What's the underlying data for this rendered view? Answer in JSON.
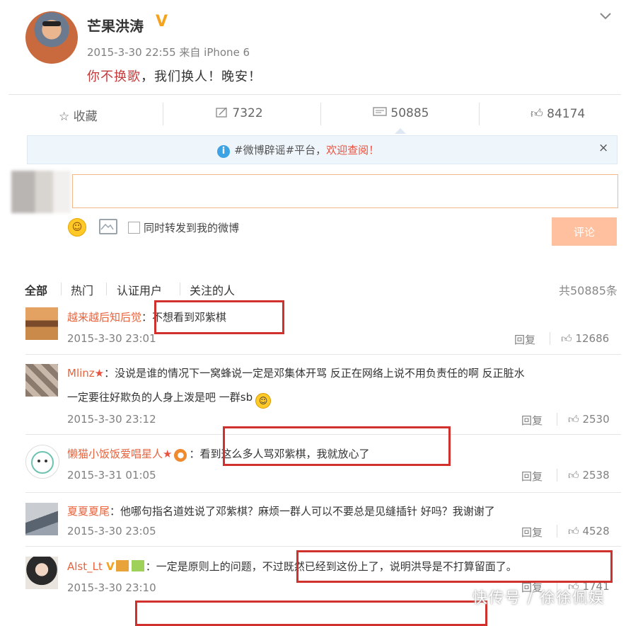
{
  "post": {
    "author": "芒果洪涛",
    "verified_badge": "V",
    "meta": "2015-3-30 22:55 来自 iPhone 6",
    "text_highlight": "你不换歌",
    "text_rest": "，我们换人！晚安！"
  },
  "actions": {
    "favorite": "收藏",
    "repost_count": "7322",
    "comment_count": "50885",
    "like_count": "84174"
  },
  "notice": {
    "text": "#微博辟谣#平台，",
    "link": "欢迎查阅！",
    "close": "×"
  },
  "composer": {
    "forward_label": "同时转发到我的微博",
    "submit_label": "评论"
  },
  "filters": {
    "all": "全部",
    "hot": "热门",
    "verified": "认证用户",
    "following": "关注的人",
    "total": "共50885条"
  },
  "comments": [
    {
      "name": "越来越后知后觉",
      "text": "：不想看到邓紫棋",
      "time": "2015-3-30 23:01",
      "reply": "回复",
      "likes": "12686"
    },
    {
      "name": "Mlinz",
      "text": "：没说是谁的情况下一窝蜂说一定是邓集体开骂 反正在网络上说不用负责任的啊 反正脏水",
      "text2": "一定要往好欺负的人身上泼是吧 一群sb",
      "time": "2015-3-30 23:12",
      "reply": "回复",
      "likes": "2530"
    },
    {
      "name": "懒猫小饭饭爱唱星人",
      "text": "：看到这么多人骂邓紫棋，我就放心了",
      "time": "2015-3-31 01:05",
      "reply": "回复",
      "likes": "2538"
    },
    {
      "name": "夏夏夏尾",
      "text": "：他哪句指名道姓说了邓紫棋？麻烦一群人可以不要总是见缝插针 好吗？我谢谢了",
      "time": "2015-3-30 23:05",
      "reply": "回复",
      "likes": "4528"
    },
    {
      "name": "Alst_Lt",
      "text": "：一定是原则上的问题，不过既然已经到这份上了，说明洪导是不打算留面了。",
      "time": "2015-3-30 23:10",
      "reply": "回复",
      "likes": "1741"
    }
  ],
  "watermark": "快传号 / 徐徐佩娱"
}
